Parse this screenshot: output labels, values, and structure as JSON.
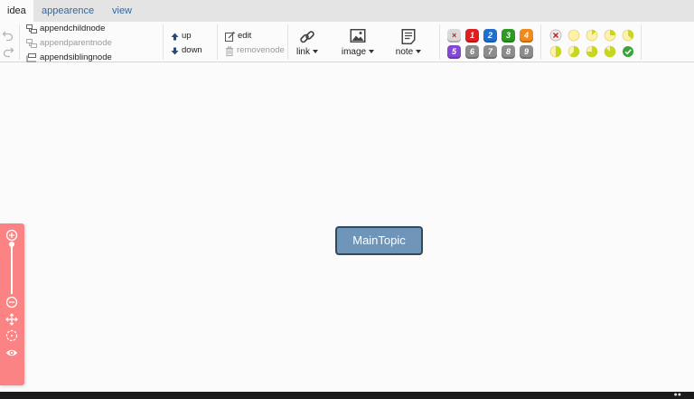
{
  "tabs": [
    {
      "label": "idea",
      "active": true
    },
    {
      "label": "appearence",
      "active": false
    },
    {
      "label": "view",
      "active": false
    }
  ],
  "toolbar": {
    "node_ops": {
      "append_child": "appendchildnode",
      "append_parent": "appendparentnode",
      "append_sibling": "appendsiblingnode"
    },
    "arrange": {
      "up": "up",
      "down": "down"
    },
    "edit_ops": {
      "edit": "edit",
      "remove": "removenode"
    },
    "insert": {
      "link": "link",
      "image": "image",
      "note": "note"
    },
    "priorities": [
      {
        "label": "×",
        "color": "#d9d9d9",
        "text_color": "#c81e1e"
      },
      {
        "label": "1",
        "color": "#e11f1f",
        "text_color": "#ffffff"
      },
      {
        "label": "2",
        "color": "#1f6fd0",
        "text_color": "#ffffff"
      },
      {
        "label": "3",
        "color": "#2d9a23",
        "text_color": "#ffffff"
      },
      {
        "label": "4",
        "color": "#f18a1b",
        "text_color": "#ffffff"
      },
      {
        "label": "5",
        "color": "#8348d4",
        "text_color": "#ffffff"
      },
      {
        "label": "6",
        "color": "#8c8c8c",
        "text_color": "#ffffff"
      },
      {
        "label": "7",
        "color": "#8c8c8c",
        "text_color": "#ffffff"
      },
      {
        "label": "8",
        "color": "#8c8c8c",
        "text_color": "#ffffff"
      },
      {
        "label": "9",
        "color": "#8c8c8c",
        "text_color": "#ffffff"
      }
    ],
    "progress": [
      {
        "level": "clear",
        "value": null
      },
      {
        "level": "0/8",
        "value": 0
      },
      {
        "level": "1/8",
        "value": 0.125
      },
      {
        "level": "2/8",
        "value": 0.25
      },
      {
        "level": "3/8",
        "value": 0.375
      },
      {
        "level": "4/8",
        "value": 0.5
      },
      {
        "level": "5/8",
        "value": 0.625
      },
      {
        "level": "6/8",
        "value": 0.75
      },
      {
        "level": "7/8",
        "value": 0.875
      },
      {
        "level": "done",
        "value": 1
      }
    ]
  },
  "canvas": {
    "main_topic": "MainTopic"
  },
  "zoom": {
    "level": 0.02
  },
  "colors": {
    "accent": "#2f68a6",
    "topic_fill": "#6f95b8",
    "topic_border": "#2e4a63",
    "zoom_panel": "#fc8383",
    "progress_fill": "#c4d91b",
    "progress_bg": "#fff2a8",
    "progress_done": "#3aa23a"
  },
  "icons": {
    "undo": "undo-icon",
    "redo": "redo-icon",
    "link": "link-icon",
    "image": "image-icon",
    "note": "note-icon",
    "zoom_in": "zoom-in-icon",
    "zoom_out": "zoom-out-icon",
    "move": "move-icon",
    "locate": "locate-icon",
    "view": "eye-icon"
  }
}
